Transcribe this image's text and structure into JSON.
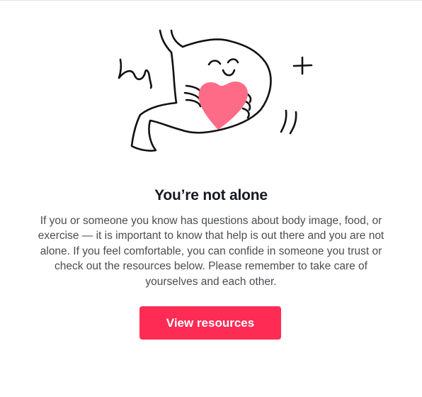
{
  "dialog": {
    "title": "You’re not alone",
    "body": "If you or someone you know has questions about body image, food, or exercise — it is important to know that help is out there and you are not alone. If you feel comfortable, you can confide in someone you trust or check out the resources below. Please remember to take care of yourselves and each other.",
    "button_label": "View resources",
    "illustration_icon": "stomach-hugging-heart-icon"
  },
  "colors": {
    "accent": "#fe2c55",
    "heart": "#fe6b86",
    "title": "#161823",
    "body_text": "#4b4c52"
  }
}
